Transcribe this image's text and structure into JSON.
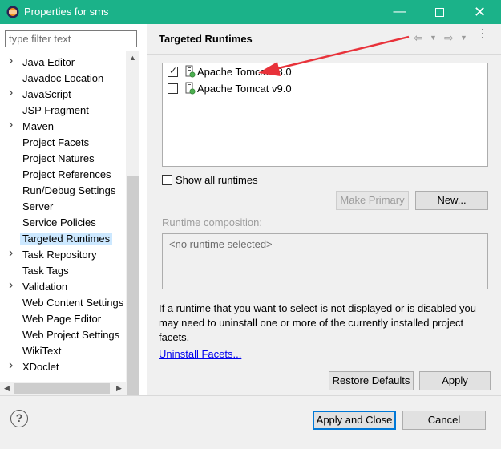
{
  "window": {
    "title": "Properties for sms",
    "title_bar_color": "#1bb289",
    "icons": {
      "app": "eclipse-icon",
      "minimize": "minimize-icon",
      "maximize": "maximize-icon",
      "close": "close-icon"
    }
  },
  "sidebar": {
    "filter_placeholder": "type filter text",
    "items": [
      {
        "label": "Java Editor",
        "expandable": true
      },
      {
        "label": "Javadoc Location",
        "expandable": false
      },
      {
        "label": "JavaScript",
        "expandable": true
      },
      {
        "label": "JSP Fragment",
        "expandable": false
      },
      {
        "label": "Maven",
        "expandable": true
      },
      {
        "label": "Project Facets",
        "expandable": false
      },
      {
        "label": "Project Natures",
        "expandable": false
      },
      {
        "label": "Project References",
        "expandable": false
      },
      {
        "label": "Run/Debug Settings",
        "expandable": false
      },
      {
        "label": "Server",
        "expandable": false
      },
      {
        "label": "Service Policies",
        "expandable": false
      },
      {
        "label": "Targeted Runtimes",
        "expandable": false,
        "selected": true
      },
      {
        "label": "Task Repository",
        "expandable": true
      },
      {
        "label": "Task Tags",
        "expandable": false
      },
      {
        "label": "Validation",
        "expandable": true
      },
      {
        "label": "Web Content Settings",
        "expandable": false
      },
      {
        "label": "Web Page Editor",
        "expandable": false
      },
      {
        "label": "Web Project Settings",
        "expandable": false
      },
      {
        "label": "WikiText",
        "expandable": false
      },
      {
        "label": "XDoclet",
        "expandable": true
      }
    ]
  },
  "page": {
    "title": "Targeted Runtimes",
    "runtimes": [
      {
        "label": "Apache Tomcat v8.0",
        "checked": true,
        "icon": "tomcat-runtime-icon"
      },
      {
        "label": "Apache Tomcat v9.0",
        "checked": false,
        "icon": "tomcat-runtime-icon"
      }
    ],
    "show_all_label": "Show all runtimes",
    "make_primary_label": "Make Primary",
    "new_label": "New...",
    "composition_label": "Runtime composition:",
    "composition_placeholder": "<no runtime selected>",
    "info_text": "If a runtime that you want to select is not displayed or is disabled you may need to uninstall one or more of the currently installed project facets.",
    "uninstall_link": "Uninstall Facets...",
    "restore_defaults_label": "Restore Defaults",
    "apply_label": "Apply"
  },
  "footer": {
    "help_icon": "help-icon",
    "apply_close_label": "Apply and Close",
    "cancel_label": "Cancel"
  },
  "annotation": {
    "arrow_color": "#e8323a"
  }
}
